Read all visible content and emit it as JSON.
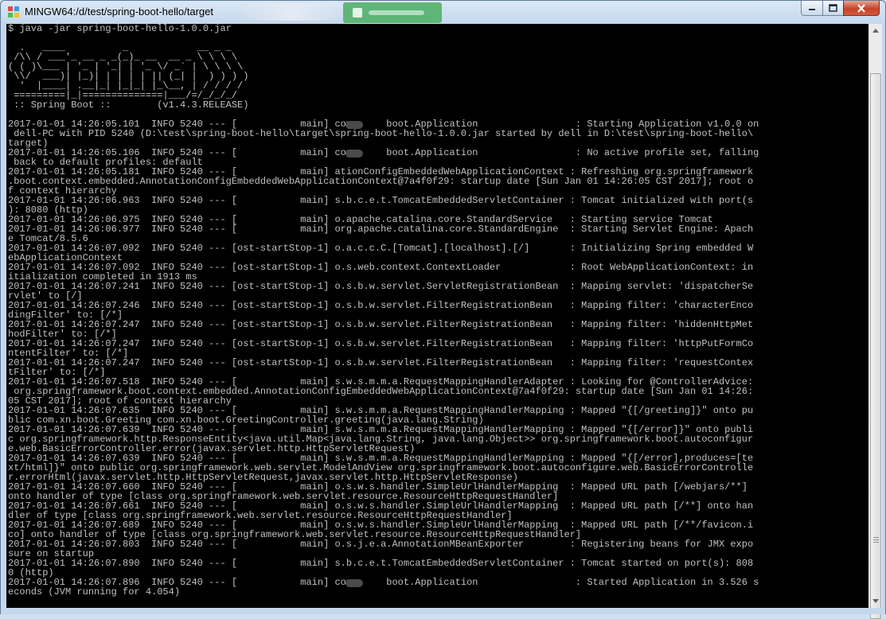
{
  "window": {
    "title": "MINGW64:/d/test/spring-boot-hello/target",
    "controls": {
      "minimize": "minimize",
      "maximize": "maximize",
      "close": "close"
    }
  },
  "console": {
    "lines": [
      "$ java -jar spring-boot-hello-1.0.0.jar",
      "",
      "  .   ____          _            __ _ _",
      " /\\\\ / ___'_ __ _ _(_)_ __  __ _ \\ \\ \\ \\",
      "( ( )\\___ | '_ | '_| | '_ \\/ _` | \\ \\ \\ \\",
      " \\\\/  ___)| |_)| | | | | || (_| |  ) ) ) )",
      "  '  |____| .__|_| |_|_| |_\\__, | / / / /",
      " =========|_|==============|___/=/_/_/_/",
      " :: Spring Boot ::        (v1.4.3.RELEASE)",
      "",
      "2017-01-01 14:26:05.101  INFO 5240 --- [           main] com.     boot.Application                 : Starting Application v1.0.0 on",
      " dell-PC with PID 5240 (D:\\test\\spring-boot-hello\\target\\spring-boot-hello-1.0.0.jar started by dell in D:\\test\\spring-boot-hello\\",
      "target)",
      "2017-01-01 14:26:05.106  INFO 5240 --- [           main] com.     boot.Application                 : No active profile set, falling",
      " back to default profiles: default",
      "2017-01-01 14:26:05.181  INFO 5240 --- [           main] ationConfigEmbeddedWebApplicationContext : Refreshing org.springframework",
      ".boot.context.embedded.AnnotationConfigEmbeddedWebApplicationContext@7a4f0f29: startup date [Sun Jan 01 14:26:05 CST 2017]; root o",
      "f context hierarchy",
      "2017-01-01 14:26:06.963  INFO 5240 --- [           main] s.b.c.e.t.TomcatEmbeddedServletContainer : Tomcat initialized with port(s",
      "): 8080 (http)",
      "2017-01-01 14:26:06.975  INFO 5240 --- [           main] o.apache.catalina.core.StandardService   : Starting service Tomcat",
      "2017-01-01 14:26:06.977  INFO 5240 --- [           main] org.apache.catalina.core.StandardEngine  : Starting Servlet Engine: Apach",
      "e Tomcat/8.5.6",
      "2017-01-01 14:26:07.092  INFO 5240 --- [ost-startStop-1] o.a.c.c.C.[Tomcat].[localhost].[/]       : Initializing Spring embedded W",
      "ebApplicationContext",
      "2017-01-01 14:26:07.092  INFO 5240 --- [ost-startStop-1] o.s.web.context.ContextLoader            : Root WebApplicationContext: in",
      "itialization completed in 1913 ms",
      "2017-01-01 14:26:07.241  INFO 5240 --- [ost-startStop-1] o.s.b.w.servlet.ServletRegistrationBean  : Mapping servlet: 'dispatcherSe",
      "rvlet' to [/]",
      "2017-01-01 14:26:07.246  INFO 5240 --- [ost-startStop-1] o.s.b.w.servlet.FilterRegistrationBean   : Mapping filter: 'characterEnco",
      "dingFilter' to: [/*]",
      "2017-01-01 14:26:07.247  INFO 5240 --- [ost-startStop-1] o.s.b.w.servlet.FilterRegistrationBean   : Mapping filter: 'hiddenHttpMet",
      "hodFilter' to: [/*]",
      "2017-01-01 14:26:07.247  INFO 5240 --- [ost-startStop-1] o.s.b.w.servlet.FilterRegistrationBean   : Mapping filter: 'httpPutFormCo",
      "ntentFilter' to: [/*]",
      "2017-01-01 14:26:07.247  INFO 5240 --- [ost-startStop-1] o.s.b.w.servlet.FilterRegistrationBean   : Mapping filter: 'requestContex",
      "tFilter' to: [/*]",
      "2017-01-01 14:26:07.518  INFO 5240 --- [           main] s.w.s.m.m.a.RequestMappingHandlerAdapter : Looking for @ControllerAdvice:",
      " org.springframework.boot.context.embedded.AnnotationConfigEmbeddedWebApplicationContext@7a4f0f29: startup date [Sun Jan 01 14:26:",
      "05 CST 2017]; root of context hierarchy",
      "2017-01-01 14:26:07.635  INFO 5240 --- [           main] s.w.s.m.m.a.RequestMappingHandlerMapping : Mapped \"{[/greeting]}\" onto pu",
      "blic com.xn.boot.Greeting com.xn.boot.GreetingController.greeting(java.lang.String)",
      "2017-01-01 14:26:07.639  INFO 5240 --- [           main] s.w.s.m.m.a.RequestMappingHandlerMapping : Mapped \"{[/error]}\" onto publi",
      "c org.springframework.http.ResponseEntity<java.util.Map<java.lang.String, java.lang.Object>> org.springframework.boot.autoconfigur",
      "e.web.BasicErrorController.error(javax.servlet.http.HttpServletRequest)",
      "2017-01-01 14:26:07.639  INFO 5240 --- [           main] s.w.s.m.m.a.RequestMappingHandlerMapping : Mapped \"{[/error],produces=[te",
      "xt/html]}\" onto public org.springframework.web.servlet.ModelAndView org.springframework.boot.autoconfigure.web.BasicErrorControlle",
      "r.errorHtml(javax.servlet.http.HttpServletRequest,javax.servlet.http.HttpServletResponse)",
      "2017-01-01 14:26:07.660  INFO 5240 --- [           main] o.s.w.s.handler.SimpleUrlHandlerMapping  : Mapped URL path [/webjars/**]",
      "onto handler of type [class org.springframework.web.servlet.resource.ResourceHttpRequestHandler]",
      "2017-01-01 14:26:07.661  INFO 5240 --- [           main] o.s.w.s.handler.SimpleUrlHandlerMapping  : Mapped URL path [/**] onto han",
      "dler of type [class org.springframework.web.servlet.resource.ResourceHttpRequestHandler]",
      "2017-01-01 14:26:07.689  INFO 5240 --- [           main] o.s.w.s.handler.SimpleUrlHandlerMapping  : Mapped URL path [/**/favicon.i",
      "co] onto handler of type [class org.springframework.web.servlet.resource.ResourceHttpRequestHandler]",
      "2017-01-01 14:26:07.803  INFO 5240 --- [           main] o.s.j.e.a.AnnotationMBeanExporter        : Registering beans for JMX expo",
      "sure on startup",
      "2017-01-01 14:26:07.890  INFO 5240 --- [           main] s.b.c.e.t.TomcatEmbeddedServletContainer : Tomcat started on port(s): 808",
      "0 (http)",
      "2017-01-01 14:26:07.896  INFO 5240 --- [           main] com.     boot.Application                 : Started Application in 3.526 s",
      "econds (JVM running for 4.054)"
    ]
  },
  "icons": {
    "app": "mingw-app-icon",
    "scroll_up": "chevron-up-icon",
    "scroll_down": "chevron-down-icon"
  },
  "colors": {
    "console_bg": "#000000",
    "console_fg": "#c0c0c0",
    "close_button": "#c7432a"
  }
}
